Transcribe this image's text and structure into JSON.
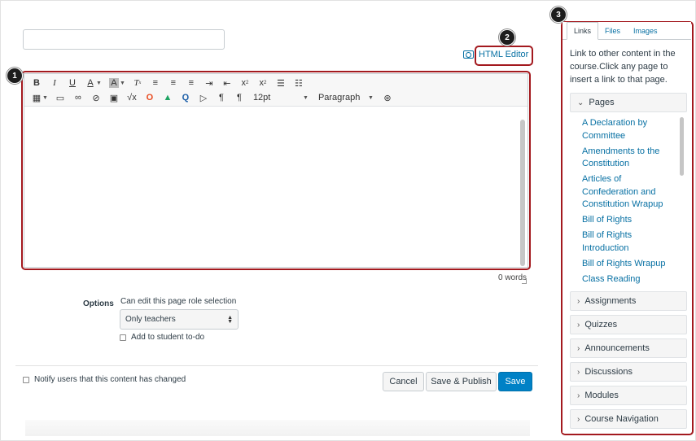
{
  "editor": {
    "font_size": "12pt",
    "block_format": "Paragraph",
    "word_count": "0 words",
    "html_editor_label": "HTML Editor",
    "toolbar_icons": [
      "bold-icon",
      "italic-icon",
      "underline-icon",
      "text-color-icon",
      "background-color-icon",
      "clear-formatting-icon",
      "align-left-icon",
      "align-center-icon",
      "align-right-icon",
      "indent-icon",
      "outdent-icon",
      "superscript-icon",
      "subscript-icon",
      "bullet-list-icon",
      "numbered-list-icon",
      "table-icon",
      "media-icon",
      "link-icon",
      "unlink-icon",
      "image-icon",
      "math-icon",
      "office-icon",
      "google-drive-icon",
      "record-icon",
      "video-icon",
      "ltr-icon",
      "rtl-icon",
      "accessibility-icon"
    ]
  },
  "options": {
    "label": "Options",
    "role_label": "Can edit this page role selection",
    "role_value": "Only teachers",
    "todo_label": "Add to student to-do"
  },
  "footer": {
    "notify_label": "Notify users that this content has changed",
    "cancel_label": "Cancel",
    "save_publish_label": "Save & Publish",
    "save_label": "Save"
  },
  "callouts": [
    "1",
    "2",
    "3"
  ],
  "sidebar": {
    "tabs": [
      "Links",
      "Files",
      "Images"
    ],
    "active_tab": "Links",
    "intro": "Link to other content in the course.Click any page to insert a link to that page.",
    "pages_header": "Pages",
    "pages": [
      "A Declaration by Committee",
      "Amendments to the Constitution",
      "Articles of Confederation and Constitution Wrapup",
      "Bill of Rights",
      "Bill of Rights Introduction",
      "Bill of Rights Wrapup",
      "Class Reading"
    ],
    "sections": [
      "Assignments",
      "Quizzes",
      "Announcements",
      "Discussions",
      "Modules",
      "Course Navigation"
    ]
  },
  "colors": {
    "accent": "#0081c6",
    "link": "#0770a3",
    "callout": "#a3191e"
  }
}
